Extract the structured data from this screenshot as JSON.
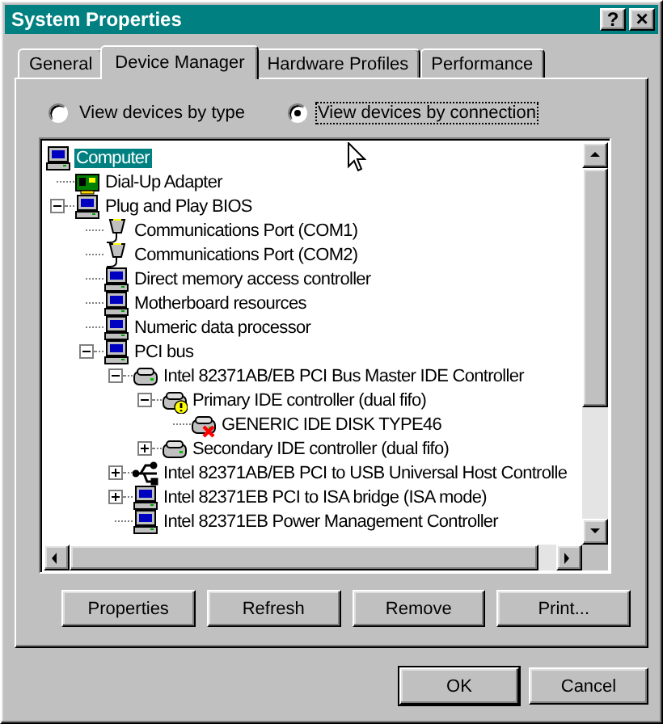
{
  "window": {
    "title": "System Properties",
    "title_buttons": [
      {
        "kind": "help",
        "label": "?"
      },
      {
        "kind": "close",
        "label": "×"
      }
    ]
  },
  "tabs": [
    {
      "label": "General",
      "selected": false
    },
    {
      "label": "Device Manager",
      "selected": true
    },
    {
      "label": "Hardware Profiles",
      "selected": false
    },
    {
      "label": "Performance",
      "selected": false
    }
  ],
  "view_options": [
    {
      "label": "View devices by type",
      "selected": false
    },
    {
      "label": "View devices by connection",
      "selected": true
    }
  ],
  "tree": [
    {
      "label": "Computer",
      "kind": "computer",
      "selected": true,
      "children": [
        {
          "label": "Dial-Up Adapter",
          "kind": "adapter",
          "selected": false
        },
        {
          "label": "Plug and Play BIOS",
          "kind": "computer",
          "selected": false,
          "expanded": true,
          "children": [
            {
              "label": "Communications Port (COM1)",
              "kind": "port",
              "selected": false
            },
            {
              "label": "Communications Port (COM2)",
              "kind": "port",
              "selected": false
            },
            {
              "label": "Direct memory access controller",
              "kind": "computer",
              "selected": false
            },
            {
              "label": "Motherboard resources",
              "kind": "computer",
              "selected": false
            },
            {
              "label": "Numeric data processor",
              "kind": "computer",
              "selected": false
            },
            {
              "label": "PCI bus",
              "kind": "computer",
              "selected": false,
              "expanded": true,
              "children": [
                {
                  "label": "Intel 82371AB/EB PCI Bus Master IDE Controller",
                  "kind": "drive",
                  "selected": false,
                  "expanded": true,
                  "children": [
                    {
                      "label": "Primary IDE controller (dual fifo)",
                      "kind": "drive-warning",
                      "selected": false,
                      "expanded": true,
                      "children": [
                        {
                          "label": "GENERIC IDE  DISK TYPE46",
                          "kind": "drive-error",
                          "selected": false
                        }
                      ]
                    },
                    {
                      "label": "Secondary IDE controller (dual fifo)",
                      "kind": "drive",
                      "selected": false,
                      "expanded": false
                    }
                  ]
                },
                {
                  "label": "Intel 82371AB/EB PCI to USB Universal Host Controlle",
                  "kind": "usb",
                  "selected": false,
                  "expanded": false
                },
                {
                  "label": "Intel 82371EB PCI to ISA bridge (ISA mode)",
                  "kind": "computer",
                  "selected": false,
                  "expanded": false
                },
                {
                  "label": "Intel 82371EB Power Management Controller",
                  "kind": "computer",
                  "selected": false
                }
              ]
            }
          ]
        }
      ]
    }
  ],
  "buttons": [
    "Properties",
    "Refresh",
    "Remove",
    "Print..."
  ],
  "dialog_buttons": [
    {
      "label": "OK",
      "default": true
    },
    {
      "label": "Cancel",
      "default": false
    }
  ]
}
